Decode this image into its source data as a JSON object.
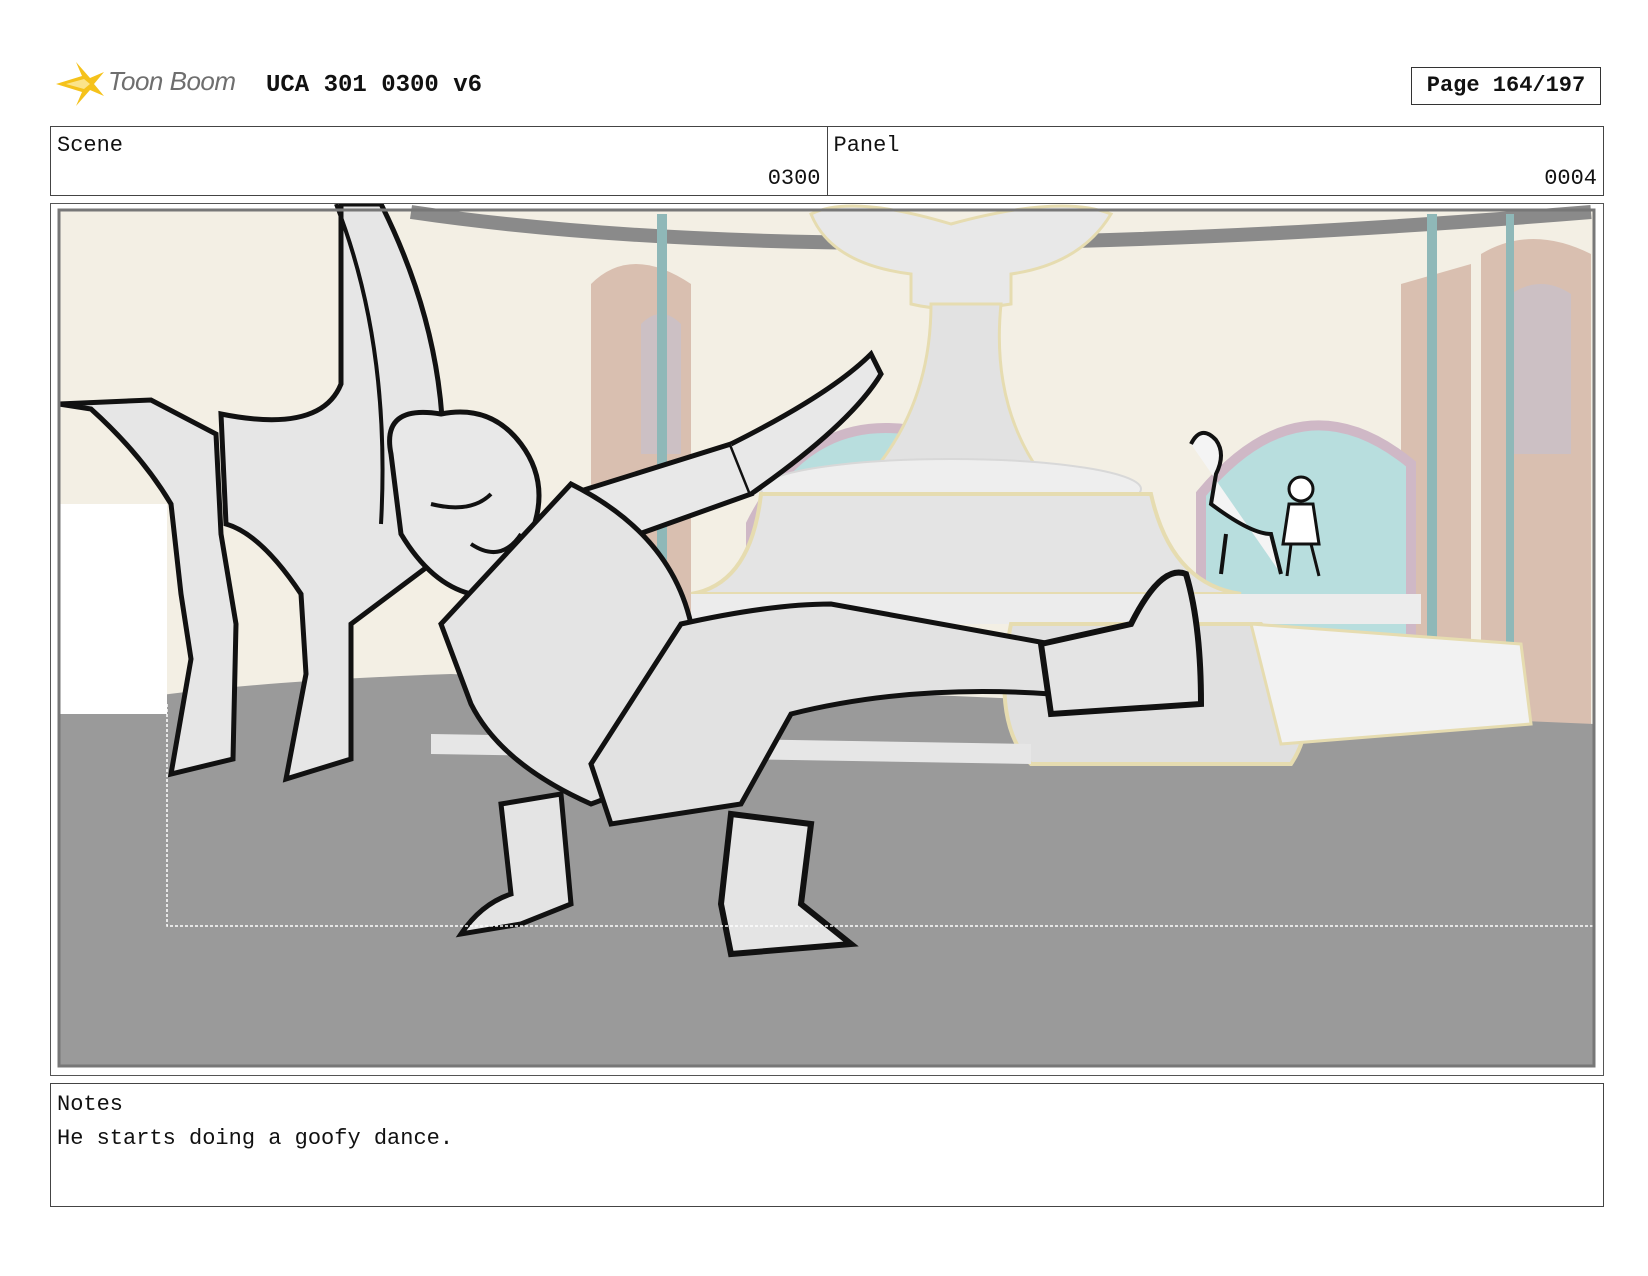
{
  "header": {
    "logo_text": "Toon Boom",
    "title": "UCA 301 0300 v6",
    "page": "Page 164/197"
  },
  "scene": {
    "label": "Scene",
    "value": "0300"
  },
  "panel": {
    "label": "Panel",
    "value": "0004"
  },
  "notes": {
    "label": "Notes",
    "text": "He starts doing a goofy dance."
  },
  "colors": {
    "floor": "#9a9a9a",
    "wall": "#f3efe4",
    "door": "#d9bfb0",
    "window": "#b8dede",
    "gold": "#e6dcb0"
  }
}
